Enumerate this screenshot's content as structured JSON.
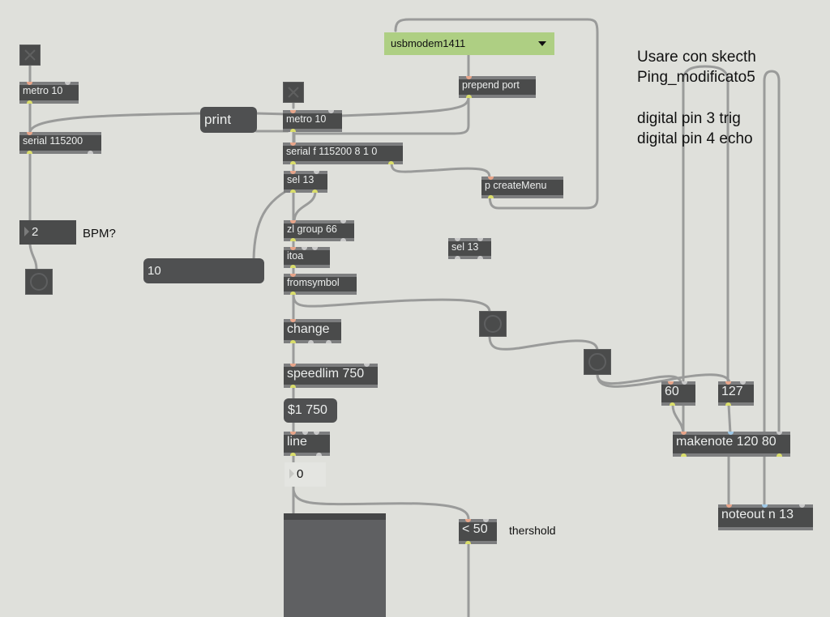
{
  "patch": {
    "comments": {
      "bpm": "BPM?",
      "usage_line1": "Usare con skecth",
      "usage_line2": "Ping_modificato5",
      "pin_trig": "digital pin 3 trig",
      "pin_echo": "digital pin 4 echo",
      "threshold": "thershold"
    },
    "left_chain": {
      "metro": "metro 10",
      "serial": "serial 115200",
      "number_value": "2"
    },
    "print_message": "print",
    "ten_message": "10",
    "serial_menu": {
      "selected": "usbmodem1411"
    },
    "main_chain": {
      "prepend": "prepend port",
      "metro": "metro 10",
      "serial": "serial f 115200 8 1 0",
      "sel_a": "sel 13",
      "create_menu": "p createMenu",
      "zl_group": "zl group 66",
      "itoa": "itoa",
      "fromsymbol": "fromsymbol",
      "sel_b": "sel 13",
      "change": "change",
      "speedlim": "speedlim 750",
      "line_msg": "$1 750",
      "line": "line",
      "line_number": "0",
      "compare": "< 50"
    },
    "note_section": {
      "pitch_msg": "60",
      "velocity_msg": "127",
      "makenote": "makenote 120 80",
      "noteout": "noteout n 13"
    },
    "colors": {
      "canvas": "#dfe0db",
      "object": "#4a4b4b",
      "umenu": "#aecf83",
      "cord": "#9a9b9b"
    }
  }
}
